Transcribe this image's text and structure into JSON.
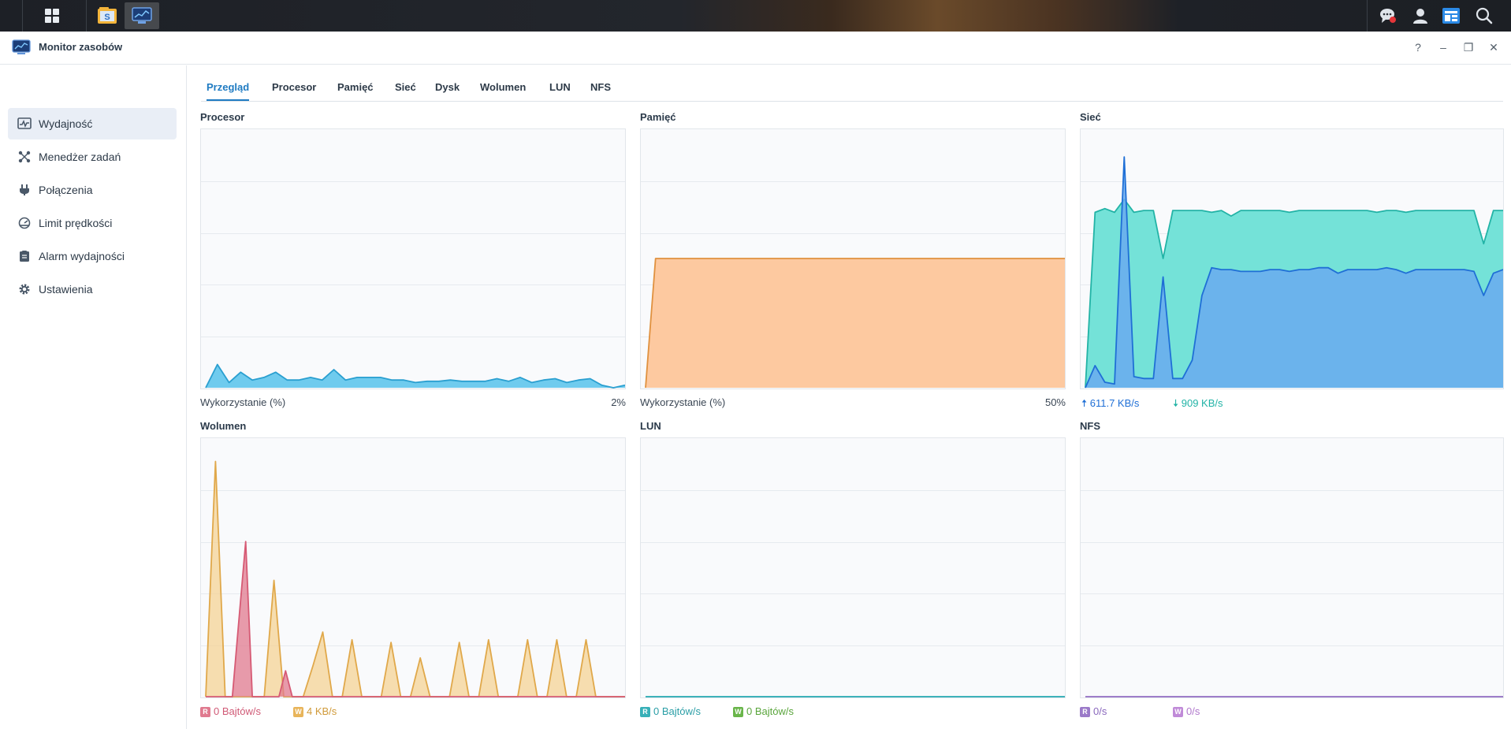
{
  "window": {
    "title": "Monitor zasobów"
  },
  "taskbar": {
    "icons": [
      "apps-grid-icon",
      "file-station-icon",
      "resource-monitor-icon",
      "chat-icon",
      "user-icon",
      "widgets-icon",
      "search-icon"
    ]
  },
  "window_controls": {
    "help": "?",
    "minimize": "–",
    "restore": "❐",
    "close": "✕"
  },
  "sidebar": {
    "items": [
      {
        "label": "Wydajność",
        "icon": "performance-icon"
      },
      {
        "label": "Menedżer zadań",
        "icon": "task-manager-icon"
      },
      {
        "label": "Połączenia",
        "icon": "plug-icon"
      },
      {
        "label": "Limit prędkości",
        "icon": "speed-limit-icon"
      },
      {
        "label": "Alarm wydajności",
        "icon": "clipboard-icon"
      },
      {
        "label": "Ustawienia",
        "icon": "gear-icon"
      }
    ]
  },
  "tabs": [
    "Przegląd",
    "Procesor",
    "Pamięć",
    "Sieć",
    "Dysk",
    "Wolumen",
    "LUN",
    "NFS"
  ],
  "panels": {
    "cpu": {
      "title": "Procesor",
      "footer_label": "Wykorzystanie  (%)",
      "footer_value": "2%"
    },
    "memory": {
      "title": "Pamięć",
      "footer_label": "Wykorzystanie  (%)",
      "footer_value": "50%"
    },
    "network": {
      "title": "Sieć",
      "upload": "611.7 KB/s",
      "download": "909 KB/s"
    },
    "volume": {
      "title": "Wolumen",
      "read_badge": "R",
      "read": "0 Bajtów/s",
      "write_badge": "W",
      "write": "4 KB/s"
    },
    "lun": {
      "title": "LUN",
      "read_badge": "R",
      "read": "0 Bajtów/s",
      "write_badge": "W",
      "write": "0 Bajtów/s"
    },
    "nfs": {
      "title": "NFS",
      "read_badge": "R",
      "read": "0/s",
      "write_badge": "W",
      "write": "0/s"
    }
  },
  "colors": {
    "cpu_fill": "#6fcbee",
    "cpu_line": "#2a9fd0",
    "mem_fill": "#fdc9a0",
    "mem_line": "#e0913f",
    "net_up_fill": "#6aaaf0",
    "net_up_line": "#1f6fd6",
    "net_down_fill": "#74e2d8",
    "net_down_line": "#22b3a6",
    "vol_read": "#e07a8f",
    "vol_write": "#f5d08e",
    "lun_read": "#38b0b8",
    "lun_write": "#69b54a",
    "nfs_read": "#9b7ac9",
    "nfs_write": "#c08ad8"
  },
  "chart_data": [
    {
      "type": "area",
      "title": "Procesor",
      "ylim": [
        0,
        100
      ],
      "grid": true,
      "series": [
        {
          "values": [
            0,
            9,
            2,
            6,
            3,
            4,
            6,
            3,
            3,
            4,
            3,
            7,
            3,
            4,
            4,
            4,
            3,
            3,
            2,
            2.5,
            2.5,
            3,
            2.5,
            2.5,
            2.5,
            3.5,
            2.5,
            4,
            2,
            3,
            3.5,
            2,
            3,
            3.5,
            1,
            0,
            1
          ]
        }
      ]
    },
    {
      "type": "area",
      "title": "Pamięć",
      "ylim": [
        0,
        100
      ],
      "grid": true,
      "series": [
        {
          "values": [
            0,
            50,
            50,
            50,
            50,
            50,
            50,
            50,
            50,
            50,
            50,
            50,
            50,
            50,
            50,
            50,
            50,
            50,
            50,
            50,
            50,
            50,
            50,
            50,
            50,
            50,
            50,
            50,
            50,
            50,
            50,
            50,
            50,
            50,
            50,
            50,
            50,
            50,
            50,
            50,
            50,
            50,
            50
          ]
        }
      ]
    },
    {
      "type": "area",
      "title": "Sieć",
      "ylim": [
        0,
        1400
      ],
      "grid": true,
      "series": [
        {
          "values": [
            0,
            120,
            30,
            20,
            1250,
            60,
            50,
            50,
            600,
            50,
            50,
            150,
            500,
            650,
            640,
            640,
            630,
            630,
            630,
            640,
            640,
            630,
            640,
            640,
            650,
            650,
            620,
            640,
            640,
            640,
            640,
            650,
            640,
            620,
            640,
            640,
            640,
            640,
            640,
            640,
            630,
            500,
            620,
            640
          ]
        },
        {
          "values": [
            0,
            950,
            970,
            950,
            1020,
            950,
            960,
            960,
            700,
            960,
            960,
            960,
            960,
            950,
            960,
            930,
            960,
            960,
            960,
            960,
            960,
            950,
            960,
            960,
            960,
            960,
            960,
            960,
            960,
            960,
            950,
            960,
            960,
            950,
            960,
            960,
            960,
            960,
            960,
            960,
            960,
            780,
            960,
            960
          ]
        }
      ]
    },
    {
      "type": "area",
      "title": "Wolumen",
      "ylim": [
        0,
        10
      ],
      "grid": true,
      "series": [
        {
          "values": [
            0,
            0,
            0,
            0,
            0,
            3,
            6,
            0,
            0,
            0,
            0,
            0,
            1,
            0,
            0,
            0,
            0,
            0,
            0,
            0,
            0,
            0,
            0,
            0,
            0,
            0,
            0,
            0,
            0,
            0,
            0,
            0,
            0,
            0,
            0,
            0,
            0,
            0,
            0,
            0,
            0,
            0,
            0,
            0,
            0,
            0,
            0,
            0,
            0,
            0,
            0,
            0,
            0,
            0,
            0,
            0,
            0,
            0,
            0,
            0,
            0,
            0,
            0,
            0
          ]
        },
        {
          "values": [
            0,
            9.1,
            0,
            0,
            0,
            0,
            0,
            4.5,
            0,
            0,
            0,
            1.2,
            2.5,
            0,
            0,
            2.2,
            0,
            0,
            0,
            2.1,
            0,
            0,
            1.5,
            0,
            0,
            0,
            2.1,
            0,
            0,
            2.2,
            0,
            0,
            0,
            2.2,
            0,
            0,
            2.2,
            0,
            0,
            2.2,
            0,
            0,
            0,
            0
          ]
        }
      ]
    },
    {
      "type": "area",
      "title": "LUN",
      "ylim": [
        0,
        10
      ],
      "grid": true,
      "series": [
        {
          "values": [
            0,
            0
          ]
        },
        {
          "values": [
            0,
            0
          ]
        }
      ]
    },
    {
      "type": "area",
      "title": "NFS",
      "ylim": [
        0,
        10
      ],
      "grid": true,
      "series": [
        {
          "values": [
            0,
            0
          ]
        },
        {
          "values": [
            0,
            0
          ]
        }
      ]
    }
  ]
}
